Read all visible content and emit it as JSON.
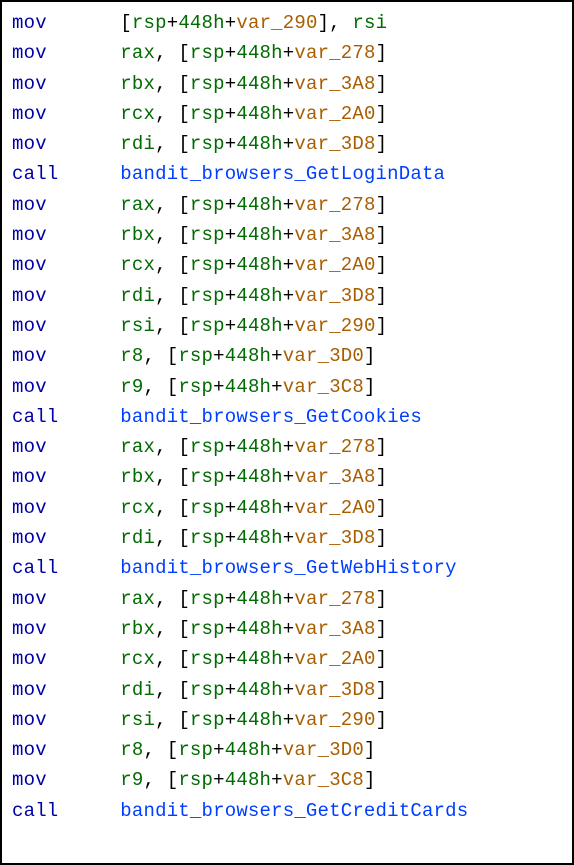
{
  "lines": [
    {
      "mnemonic": "mov",
      "parts": [
        {
          "t": "punct",
          "v": "["
        },
        {
          "t": "reg",
          "v": "rsp"
        },
        {
          "t": "punct",
          "v": "+"
        },
        {
          "t": "hex",
          "v": "448h"
        },
        {
          "t": "punct",
          "v": "+"
        },
        {
          "t": "var",
          "v": "var_290"
        },
        {
          "t": "punct",
          "v": "], "
        },
        {
          "t": "reg",
          "v": "rsi"
        }
      ]
    },
    {
      "mnemonic": "mov",
      "parts": [
        {
          "t": "reg",
          "v": "rax"
        },
        {
          "t": "punct",
          "v": ", ["
        },
        {
          "t": "reg",
          "v": "rsp"
        },
        {
          "t": "punct",
          "v": "+"
        },
        {
          "t": "hex",
          "v": "448h"
        },
        {
          "t": "punct",
          "v": "+"
        },
        {
          "t": "var",
          "v": "var_278"
        },
        {
          "t": "punct",
          "v": "]"
        }
      ]
    },
    {
      "mnemonic": "mov",
      "parts": [
        {
          "t": "reg",
          "v": "rbx"
        },
        {
          "t": "punct",
          "v": ", ["
        },
        {
          "t": "reg",
          "v": "rsp"
        },
        {
          "t": "punct",
          "v": "+"
        },
        {
          "t": "hex",
          "v": "448h"
        },
        {
          "t": "punct",
          "v": "+"
        },
        {
          "t": "var",
          "v": "var_3A8"
        },
        {
          "t": "punct",
          "v": "]"
        }
      ]
    },
    {
      "mnemonic": "mov",
      "parts": [
        {
          "t": "reg",
          "v": "rcx"
        },
        {
          "t": "punct",
          "v": ", ["
        },
        {
          "t": "reg",
          "v": "rsp"
        },
        {
          "t": "punct",
          "v": "+"
        },
        {
          "t": "hex",
          "v": "448h"
        },
        {
          "t": "punct",
          "v": "+"
        },
        {
          "t": "var",
          "v": "var_2A0"
        },
        {
          "t": "punct",
          "v": "]"
        }
      ]
    },
    {
      "mnemonic": "mov",
      "parts": [
        {
          "t": "reg",
          "v": "rdi"
        },
        {
          "t": "punct",
          "v": ", ["
        },
        {
          "t": "reg",
          "v": "rsp"
        },
        {
          "t": "punct",
          "v": "+"
        },
        {
          "t": "hex",
          "v": "448h"
        },
        {
          "t": "punct",
          "v": "+"
        },
        {
          "t": "var",
          "v": "var_3D8"
        },
        {
          "t": "punct",
          "v": "]"
        }
      ]
    },
    {
      "mnemonic": "call",
      "parts": [
        {
          "t": "func",
          "v": "bandit_browsers_GetLoginData"
        }
      ]
    },
    {
      "mnemonic": "mov",
      "parts": [
        {
          "t": "reg",
          "v": "rax"
        },
        {
          "t": "punct",
          "v": ", ["
        },
        {
          "t": "reg",
          "v": "rsp"
        },
        {
          "t": "punct",
          "v": "+"
        },
        {
          "t": "hex",
          "v": "448h"
        },
        {
          "t": "punct",
          "v": "+"
        },
        {
          "t": "var",
          "v": "var_278"
        },
        {
          "t": "punct",
          "v": "]"
        }
      ]
    },
    {
      "mnemonic": "mov",
      "parts": [
        {
          "t": "reg",
          "v": "rbx"
        },
        {
          "t": "punct",
          "v": ", ["
        },
        {
          "t": "reg",
          "v": "rsp"
        },
        {
          "t": "punct",
          "v": "+"
        },
        {
          "t": "hex",
          "v": "448h"
        },
        {
          "t": "punct",
          "v": "+"
        },
        {
          "t": "var",
          "v": "var_3A8"
        },
        {
          "t": "punct",
          "v": "]"
        }
      ]
    },
    {
      "mnemonic": "mov",
      "parts": [
        {
          "t": "reg",
          "v": "rcx"
        },
        {
          "t": "punct",
          "v": ", ["
        },
        {
          "t": "reg",
          "v": "rsp"
        },
        {
          "t": "punct",
          "v": "+"
        },
        {
          "t": "hex",
          "v": "448h"
        },
        {
          "t": "punct",
          "v": "+"
        },
        {
          "t": "var",
          "v": "var_2A0"
        },
        {
          "t": "punct",
          "v": "]"
        }
      ]
    },
    {
      "mnemonic": "mov",
      "parts": [
        {
          "t": "reg",
          "v": "rdi"
        },
        {
          "t": "punct",
          "v": ", ["
        },
        {
          "t": "reg",
          "v": "rsp"
        },
        {
          "t": "punct",
          "v": "+"
        },
        {
          "t": "hex",
          "v": "448h"
        },
        {
          "t": "punct",
          "v": "+"
        },
        {
          "t": "var",
          "v": "var_3D8"
        },
        {
          "t": "punct",
          "v": "]"
        }
      ]
    },
    {
      "mnemonic": "mov",
      "parts": [
        {
          "t": "reg",
          "v": "rsi"
        },
        {
          "t": "punct",
          "v": ", ["
        },
        {
          "t": "reg",
          "v": "rsp"
        },
        {
          "t": "punct",
          "v": "+"
        },
        {
          "t": "hex",
          "v": "448h"
        },
        {
          "t": "punct",
          "v": "+"
        },
        {
          "t": "var",
          "v": "var_290"
        },
        {
          "t": "punct",
          "v": "]"
        }
      ]
    },
    {
      "mnemonic": "mov",
      "parts": [
        {
          "t": "reg",
          "v": "r8"
        },
        {
          "t": "punct",
          "v": ", ["
        },
        {
          "t": "reg",
          "v": "rsp"
        },
        {
          "t": "punct",
          "v": "+"
        },
        {
          "t": "hex",
          "v": "448h"
        },
        {
          "t": "punct",
          "v": "+"
        },
        {
          "t": "var",
          "v": "var_3D0"
        },
        {
          "t": "punct",
          "v": "]"
        }
      ]
    },
    {
      "mnemonic": "mov",
      "parts": [
        {
          "t": "reg",
          "v": "r9"
        },
        {
          "t": "punct",
          "v": ", ["
        },
        {
          "t": "reg",
          "v": "rsp"
        },
        {
          "t": "punct",
          "v": "+"
        },
        {
          "t": "hex",
          "v": "448h"
        },
        {
          "t": "punct",
          "v": "+"
        },
        {
          "t": "var",
          "v": "var_3C8"
        },
        {
          "t": "punct",
          "v": "]"
        }
      ]
    },
    {
      "mnemonic": "call",
      "parts": [
        {
          "t": "func",
          "v": "bandit_browsers_GetCookies"
        }
      ]
    },
    {
      "mnemonic": "mov",
      "parts": [
        {
          "t": "reg",
          "v": "rax"
        },
        {
          "t": "punct",
          "v": ", ["
        },
        {
          "t": "reg",
          "v": "rsp"
        },
        {
          "t": "punct",
          "v": "+"
        },
        {
          "t": "hex",
          "v": "448h"
        },
        {
          "t": "punct",
          "v": "+"
        },
        {
          "t": "var",
          "v": "var_278"
        },
        {
          "t": "punct",
          "v": "]"
        }
      ]
    },
    {
      "mnemonic": "mov",
      "parts": [
        {
          "t": "reg",
          "v": "rbx"
        },
        {
          "t": "punct",
          "v": ", ["
        },
        {
          "t": "reg",
          "v": "rsp"
        },
        {
          "t": "punct",
          "v": "+"
        },
        {
          "t": "hex",
          "v": "448h"
        },
        {
          "t": "punct",
          "v": "+"
        },
        {
          "t": "var",
          "v": "var_3A8"
        },
        {
          "t": "punct",
          "v": "]"
        }
      ]
    },
    {
      "mnemonic": "mov",
      "parts": [
        {
          "t": "reg",
          "v": "rcx"
        },
        {
          "t": "punct",
          "v": ", ["
        },
        {
          "t": "reg",
          "v": "rsp"
        },
        {
          "t": "punct",
          "v": "+"
        },
        {
          "t": "hex",
          "v": "448h"
        },
        {
          "t": "punct",
          "v": "+"
        },
        {
          "t": "var",
          "v": "var_2A0"
        },
        {
          "t": "punct",
          "v": "]"
        }
      ]
    },
    {
      "mnemonic": "mov",
      "parts": [
        {
          "t": "reg",
          "v": "rdi"
        },
        {
          "t": "punct",
          "v": ", ["
        },
        {
          "t": "reg",
          "v": "rsp"
        },
        {
          "t": "punct",
          "v": "+"
        },
        {
          "t": "hex",
          "v": "448h"
        },
        {
          "t": "punct",
          "v": "+"
        },
        {
          "t": "var",
          "v": "var_3D8"
        },
        {
          "t": "punct",
          "v": "]"
        }
      ]
    },
    {
      "mnemonic": "call",
      "parts": [
        {
          "t": "func",
          "v": "bandit_browsers_GetWebHistory"
        }
      ]
    },
    {
      "mnemonic": "mov",
      "parts": [
        {
          "t": "reg",
          "v": "rax"
        },
        {
          "t": "punct",
          "v": ", ["
        },
        {
          "t": "reg",
          "v": "rsp"
        },
        {
          "t": "punct",
          "v": "+"
        },
        {
          "t": "hex",
          "v": "448h"
        },
        {
          "t": "punct",
          "v": "+"
        },
        {
          "t": "var",
          "v": "var_278"
        },
        {
          "t": "punct",
          "v": "]"
        }
      ]
    },
    {
      "mnemonic": "mov",
      "parts": [
        {
          "t": "reg",
          "v": "rbx"
        },
        {
          "t": "punct",
          "v": ", ["
        },
        {
          "t": "reg",
          "v": "rsp"
        },
        {
          "t": "punct",
          "v": "+"
        },
        {
          "t": "hex",
          "v": "448h"
        },
        {
          "t": "punct",
          "v": "+"
        },
        {
          "t": "var",
          "v": "var_3A8"
        },
        {
          "t": "punct",
          "v": "]"
        }
      ]
    },
    {
      "mnemonic": "mov",
      "parts": [
        {
          "t": "reg",
          "v": "rcx"
        },
        {
          "t": "punct",
          "v": ", ["
        },
        {
          "t": "reg",
          "v": "rsp"
        },
        {
          "t": "punct",
          "v": "+"
        },
        {
          "t": "hex",
          "v": "448h"
        },
        {
          "t": "punct",
          "v": "+"
        },
        {
          "t": "var",
          "v": "var_2A0"
        },
        {
          "t": "punct",
          "v": "]"
        }
      ]
    },
    {
      "mnemonic": "mov",
      "parts": [
        {
          "t": "reg",
          "v": "rdi"
        },
        {
          "t": "punct",
          "v": ", ["
        },
        {
          "t": "reg",
          "v": "rsp"
        },
        {
          "t": "punct",
          "v": "+"
        },
        {
          "t": "hex",
          "v": "448h"
        },
        {
          "t": "punct",
          "v": "+"
        },
        {
          "t": "var",
          "v": "var_3D8"
        },
        {
          "t": "punct",
          "v": "]"
        }
      ]
    },
    {
      "mnemonic": "mov",
      "parts": [
        {
          "t": "reg",
          "v": "rsi"
        },
        {
          "t": "punct",
          "v": ", ["
        },
        {
          "t": "reg",
          "v": "rsp"
        },
        {
          "t": "punct",
          "v": "+"
        },
        {
          "t": "hex",
          "v": "448h"
        },
        {
          "t": "punct",
          "v": "+"
        },
        {
          "t": "var",
          "v": "var_290"
        },
        {
          "t": "punct",
          "v": "]"
        }
      ]
    },
    {
      "mnemonic": "mov",
      "parts": [
        {
          "t": "reg",
          "v": "r8"
        },
        {
          "t": "punct",
          "v": ", ["
        },
        {
          "t": "reg",
          "v": "rsp"
        },
        {
          "t": "punct",
          "v": "+"
        },
        {
          "t": "hex",
          "v": "448h"
        },
        {
          "t": "punct",
          "v": "+"
        },
        {
          "t": "var",
          "v": "var_3D0"
        },
        {
          "t": "punct",
          "v": "]"
        }
      ]
    },
    {
      "mnemonic": "mov",
      "parts": [
        {
          "t": "reg",
          "v": "r9"
        },
        {
          "t": "punct",
          "v": ", ["
        },
        {
          "t": "reg",
          "v": "rsp"
        },
        {
          "t": "punct",
          "v": "+"
        },
        {
          "t": "hex",
          "v": "448h"
        },
        {
          "t": "punct",
          "v": "+"
        },
        {
          "t": "var",
          "v": "var_3C8"
        },
        {
          "t": "punct",
          "v": "]"
        }
      ]
    },
    {
      "mnemonic": "call",
      "parts": [
        {
          "t": "func",
          "v": "bandit_browsers_GetCreditCards"
        }
      ]
    }
  ]
}
